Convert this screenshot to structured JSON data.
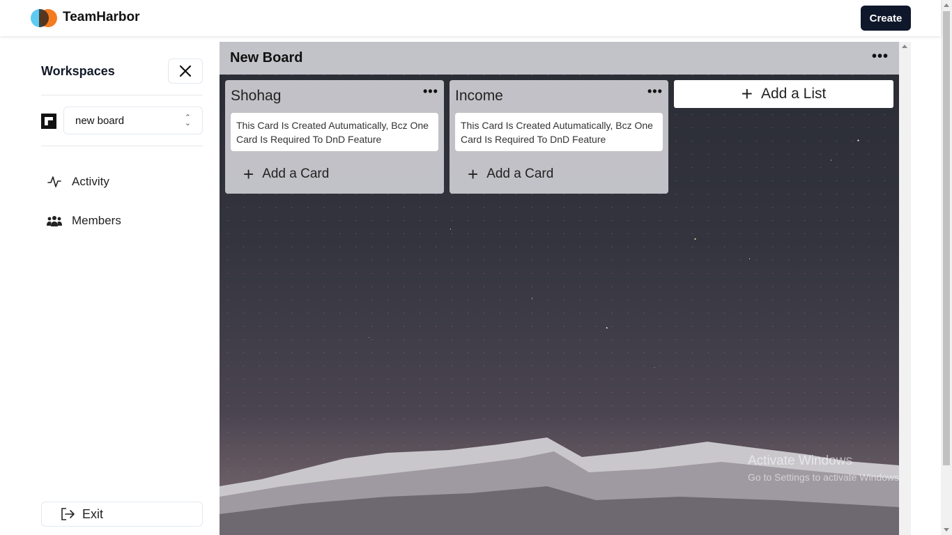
{
  "app": {
    "brand": "TeamHarbor",
    "create_label": "Create"
  },
  "sidebar": {
    "title": "Workspaces",
    "selected_board": "new board",
    "items": [
      {
        "label": "Activity",
        "icon": "activity-icon"
      },
      {
        "label": "Members",
        "icon": "members-icon"
      }
    ],
    "exit_label": "Exit"
  },
  "board": {
    "title": "New Board",
    "lists": [
      {
        "title": "Shohag",
        "card": "This Card Is Created Autumatically, Bcz One Card Is Required To DnD Feature",
        "add_card_label": "Add a Card"
      },
      {
        "title": "Income",
        "card": "This Card Is Created Autumatically, Bcz One Card Is Required To DnD Feature",
        "add_card_label": "Add a Card"
      }
    ],
    "add_list_label": "Add a List"
  },
  "watermark": {
    "line1": "Activate Windows",
    "line2": "Go to Settings to activate Windows."
  }
}
